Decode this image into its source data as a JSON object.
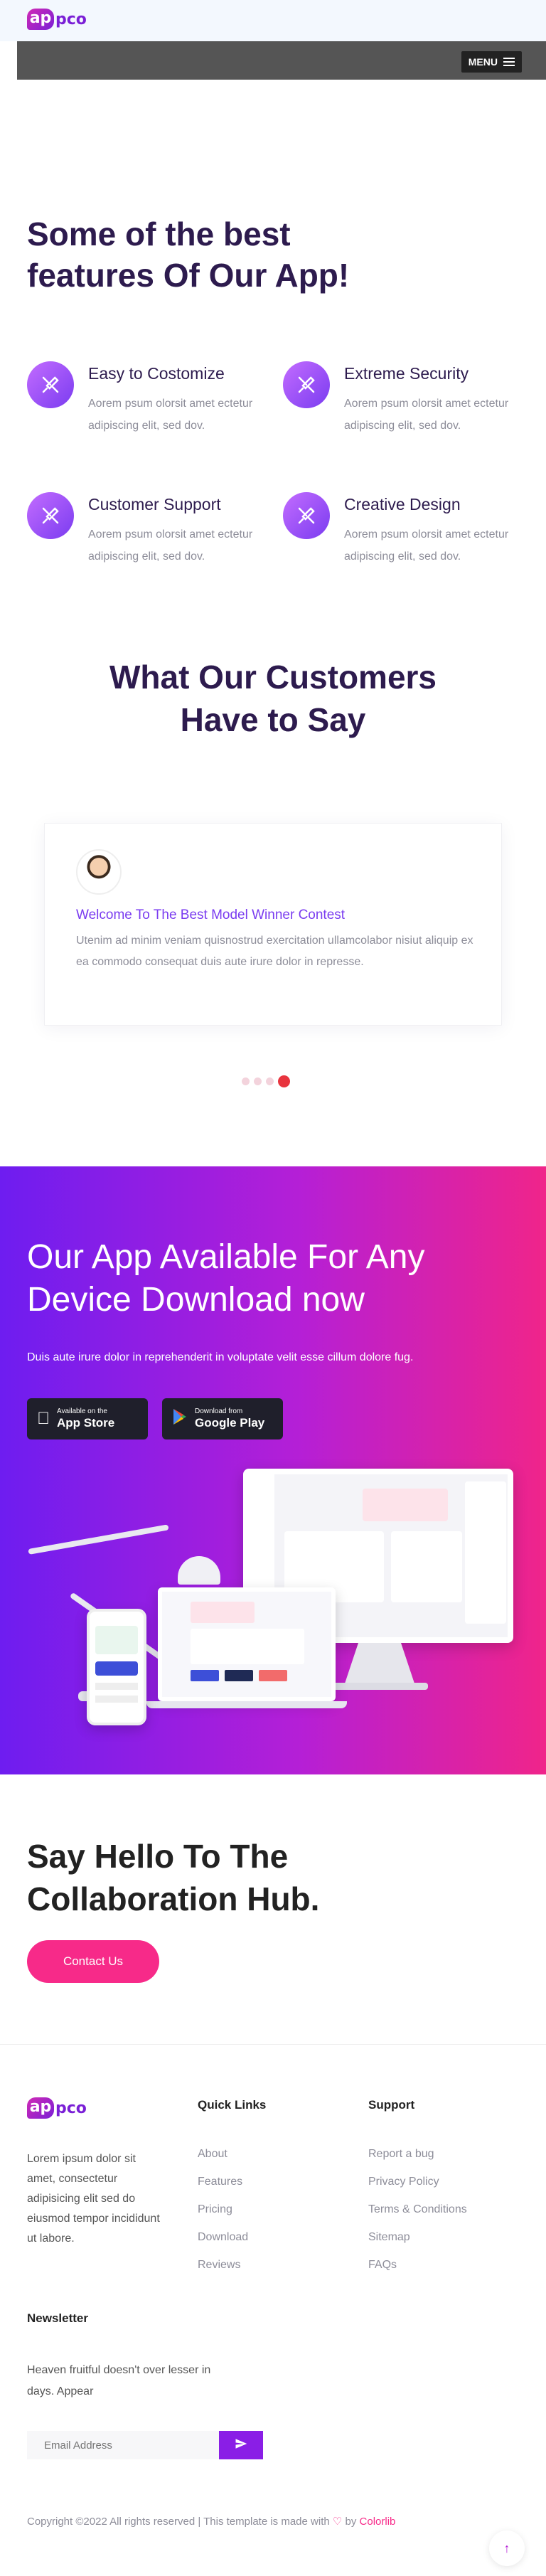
{
  "header": {
    "logo_mark": "ap",
    "logo_text": "pco",
    "menu_label": "MENU"
  },
  "features": {
    "title_line1": "Some of the best",
    "title_line2": "features Of Our App!",
    "items": [
      {
        "title": "Easy to Costomize",
        "desc": "Aorem psum olorsit amet ectetur adipiscing elit, sed dov.",
        "icon": "tools-icon"
      },
      {
        "title": "Extreme Security",
        "desc": "Aorem psum olorsit amet ectetur adipiscing elit, sed dov.",
        "icon": "tools-icon"
      },
      {
        "title": "Customer Support",
        "desc": "Aorem psum olorsit amet ectetur adipiscing elit, sed dov.",
        "icon": "tools-icon"
      },
      {
        "title": "Creative Design",
        "desc": "Aorem psum olorsit amet ectetur adipiscing elit, sed dov.",
        "icon": "tools-icon"
      }
    ]
  },
  "testimonials": {
    "title_line1": "What Our Customers",
    "title_line2": "Have to Say",
    "heading": "Welcome To The Best Model Winner Contest",
    "text": "Utenim ad minim veniam quisnostrud exercitation ullamcolabor nisiut aliquip ex ea commodo consequat duis aute irure dolor in represse.",
    "dot_count": 4,
    "active_dot": 4
  },
  "download": {
    "title_line1": "Our App Available For Any",
    "title_line2": "Device Download now",
    "subtitle": "Duis aute irure dolor in reprehenderit in voluptate velit esse cillum dolore fug.",
    "app_store_small": "Available on the",
    "app_store_big": "App Store",
    "play_small": "Download from",
    "play_big": "Google Play"
  },
  "hello": {
    "title_line1": "Say Hello To The",
    "title_line2": "Collaboration Hub.",
    "contact_label": "Contact Us"
  },
  "footer": {
    "about": "Lorem ipsum dolor sit amet, consectetur adipisicing elit sed do eiusmod tempor incididunt ut labore.",
    "quick_links_title": "Quick Links",
    "quick_links": [
      "About",
      "Features",
      "Pricing",
      "Download",
      "Reviews"
    ],
    "support_title": "Support",
    "support_links": [
      "Report a bug",
      "Privacy Policy",
      "Terms & Conditions",
      "Sitemap",
      "FAQs"
    ],
    "newsletter_title": "Newsletter",
    "newsletter_text": "Heaven fruitful doesn't over lesser in days. Appear",
    "email_placeholder": "Email Address",
    "copyright_prefix": "Copyright ©2022 All rights reserved | This template is made with",
    "copyright_by": "by",
    "copyright_brand": "Colorlib"
  },
  "colors": {
    "primary_dark": "#2d1b4e",
    "accent_purple": "#7a3cf0",
    "accent_pink": "#f72a89"
  }
}
